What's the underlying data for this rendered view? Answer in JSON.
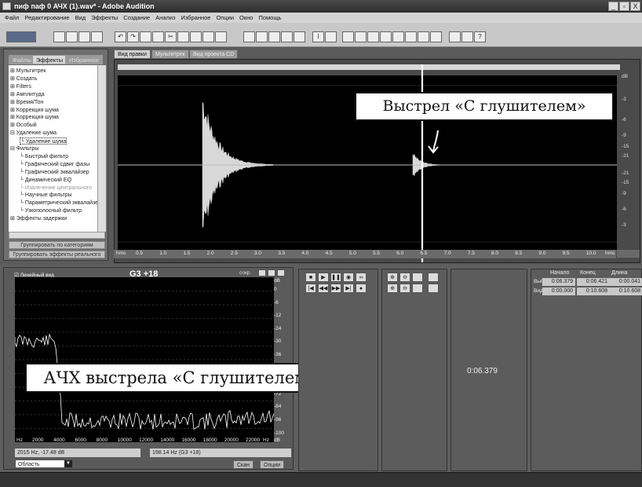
{
  "window": {
    "title": "пиф паф 0 АЧХ (1).wav* - Adobe Audition",
    "min": "_",
    "max": "▫",
    "close": "X"
  },
  "menu": [
    "Файл",
    "Редактирование",
    "Вид",
    "Эффекты",
    "Создание",
    "Анализ",
    "Избранное",
    "Опции",
    "Окно",
    "Помощь"
  ],
  "left_panel": {
    "tabs": [
      "Файлы",
      "Эффекты",
      "Избранное"
    ],
    "active_tab": 1,
    "tree": [
      {
        "label": "Мультитрек",
        "indent": 0,
        "exp": "+"
      },
      {
        "label": "Создать",
        "indent": 0,
        "exp": "+"
      },
      {
        "label": "Filters",
        "indent": 0,
        "exp": "+"
      },
      {
        "label": "Амплитуда",
        "indent": 0,
        "exp": "+"
      },
      {
        "label": "Время/Тон",
        "indent": 0,
        "exp": "+"
      },
      {
        "label": "Коррекция шума",
        "indent": 0,
        "exp": "+"
      },
      {
        "label": "Коррекция шума",
        "indent": 0,
        "exp": "+"
      },
      {
        "label": "Особый",
        "indent": 0,
        "exp": "+"
      },
      {
        "label": "Удаление шума",
        "indent": 0,
        "exp": "-"
      },
      {
        "label": "Удаление шума",
        "indent": 1,
        "exp": "",
        "selected": true
      },
      {
        "label": "Фильтры",
        "indent": 0,
        "exp": "-"
      },
      {
        "label": "Быстрый фильтр",
        "indent": 1,
        "exp": ""
      },
      {
        "label": "Графический сдвиг фазы",
        "indent": 1,
        "exp": ""
      },
      {
        "label": "Графический эквалайзер",
        "indent": 1,
        "exp": ""
      },
      {
        "label": "Динамический EQ",
        "indent": 1,
        "exp": ""
      },
      {
        "label": "Извлечение центрального",
        "indent": 1,
        "exp": "",
        "dim": true
      },
      {
        "label": "Научные фильтры",
        "indent": 1,
        "exp": ""
      },
      {
        "label": "Параметрический эквалайзер",
        "indent": 1,
        "exp": ""
      },
      {
        "label": "Узкополосный фильтр",
        "indent": 1,
        "exp": ""
      },
      {
        "label": "Эффекты задержки",
        "indent": 0,
        "exp": "+"
      }
    ],
    "group_btn": "Группировать по категориям",
    "realtime_btn": "Группировать эффекты реального"
  },
  "editor_tabs": [
    "Вид правки",
    "Мультитрек",
    "Вид проекта CD"
  ],
  "callout_top": "Выстрел «С глушителем»",
  "callout_bottom": "АЧХ выстрела «С глушителем»",
  "db_labels": [
    "dB",
    "-3",
    "-6",
    "-9",
    "-15",
    "-21",
    "-21",
    "-15",
    "-9",
    "-6",
    "-3"
  ],
  "time_ruler": {
    "unit": "hms",
    "labels": [
      "0.5",
      "1.0",
      "1.5",
      "2.0",
      "2.5",
      "3.0",
      "3.5",
      "4.0",
      "4.5",
      "5.0",
      "5.5",
      "6.0",
      "6.5",
      "7.0",
      "7.5",
      "8.0",
      "8.5",
      "9.0",
      "9.5",
      "10.0"
    ]
  },
  "freq_panel": {
    "title": "G3 +18",
    "linear": "Линейный вид",
    "db_label": "dB",
    "y_labels": [
      "0",
      "-6",
      "-12",
      "-24",
      "-30",
      "-36",
      "-48",
      "-60",
      "-72",
      "-84",
      "-96",
      "-100"
    ],
    "x_unit": "Hz",
    "x_labels": [
      "2000",
      "4000",
      "6000",
      "8000",
      "10000",
      "12000",
      "14000",
      "16000",
      "18000",
      "20000",
      "22000"
    ],
    "status_left": "2015 Hz, -17.48 dB",
    "status_right": "198.14 Hz (G3 +18)",
    "area": "Область",
    "btn_scan": "Скан",
    "btn_options": "Опции",
    "corner_label": "сокр."
  },
  "time_display": "0:06.379",
  "selection": {
    "headers": [
      "Начало",
      "Конец",
      "Длина"
    ],
    "rows": [
      {
        "label": "Выбор",
        "values": [
          "0:06.379",
          "0:06.421",
          "0:00.041"
        ]
      },
      {
        "label": "Вид",
        "values": [
          "0:00.000",
          "0:10.608",
          "0:10.608"
        ]
      }
    ]
  }
}
